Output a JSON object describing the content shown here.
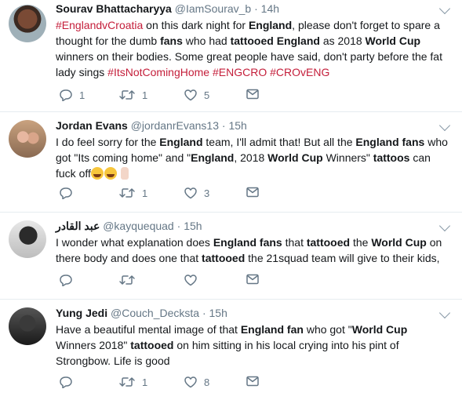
{
  "tweets": [
    {
      "name": "Sourav Bhattacharyya",
      "handle": "@IamSourav_b",
      "sep": " · ",
      "time": "14h",
      "parts": [
        {
          "t": "#EnglandvCroatia",
          "s": "tag"
        },
        {
          "t": " on this dark night for ",
          "s": "n"
        },
        {
          "t": "England",
          "s": "b"
        },
        {
          "t": ", please don't forget to spare a thought for the dumb ",
          "s": "n"
        },
        {
          "t": "fans",
          "s": "b"
        },
        {
          "t": " who had ",
          "s": "n"
        },
        {
          "t": "tattooed England",
          "s": "b"
        },
        {
          "t": " as 2018 ",
          "s": "n"
        },
        {
          "t": "World Cup",
          "s": "b"
        },
        {
          "t": " winners on their bodies. Some great people have said, don't party before the fat lady sings ",
          "s": "n"
        },
        {
          "t": "#ItsNotComingHome",
          "s": "tag"
        },
        {
          "t": " ",
          "s": "n"
        },
        {
          "t": "#ENGCRO",
          "s": "tag"
        },
        {
          "t": " ",
          "s": "n"
        },
        {
          "t": "#CROvENG",
          "s": "tag"
        }
      ],
      "replies": "1",
      "retweets": "1",
      "likes": "5"
    },
    {
      "name": "Jordan Evans",
      "handle": "@jordanrEvans13",
      "sep": " · ",
      "time": "15h",
      "parts": [
        {
          "t": "I do feel sorry for the ",
          "s": "n"
        },
        {
          "t": "England",
          "s": "b"
        },
        {
          "t": " team, I'll admit that! But all the ",
          "s": "n"
        },
        {
          "t": "England fans",
          "s": "b"
        },
        {
          "t": " who got \"Its coming home\" and \"",
          "s": "n"
        },
        {
          "t": "England",
          "s": "b"
        },
        {
          "t": ", 2018 ",
          "s": "n"
        },
        {
          "t": "World Cup",
          "s": "b"
        },
        {
          "t": " Winners\" ",
          "s": "n"
        },
        {
          "t": "tattoos",
          "s": "b"
        },
        {
          "t": " can fuck off",
          "s": "n"
        }
      ],
      "replies": "",
      "retweets": "1",
      "likes": "3"
    },
    {
      "name": "عبد القادر",
      "handle": "@kayquequad",
      "sep": " · ",
      "time": "15h",
      "parts": [
        {
          "t": "I wonder what explanation does ",
          "s": "n"
        },
        {
          "t": "England fans",
          "s": "b"
        },
        {
          "t": " that ",
          "s": "n"
        },
        {
          "t": "tattooed",
          "s": "b"
        },
        {
          "t": " the ",
          "s": "n"
        },
        {
          "t": "World Cup",
          "s": "b"
        },
        {
          "t": " on there body and does one that ",
          "s": "n"
        },
        {
          "t": "tattooed",
          "s": "b"
        },
        {
          "t": " the 21squad team will give to their kids,",
          "s": "n"
        }
      ],
      "replies": "",
      "retweets": "",
      "likes": ""
    },
    {
      "name": "Yung Jedi",
      "handle": "@Couch_Decksta",
      "sep": " · ",
      "time": "15h",
      "parts": [
        {
          "t": "Have a beautiful mental image of that ",
          "s": "n"
        },
        {
          "t": "England fan",
          "s": "b"
        },
        {
          "t": " who got \"",
          "s": "n"
        },
        {
          "t": "World Cup",
          "s": "b"
        },
        {
          "t": " Winners 2018\" ",
          "s": "n"
        },
        {
          "t": "tattooed",
          "s": "b"
        },
        {
          "t": " on him sitting in his local crying into his pint of Strongbow. Life is good",
          "s": "n"
        }
      ],
      "replies": "",
      "retweets": "1",
      "likes": "8"
    }
  ]
}
